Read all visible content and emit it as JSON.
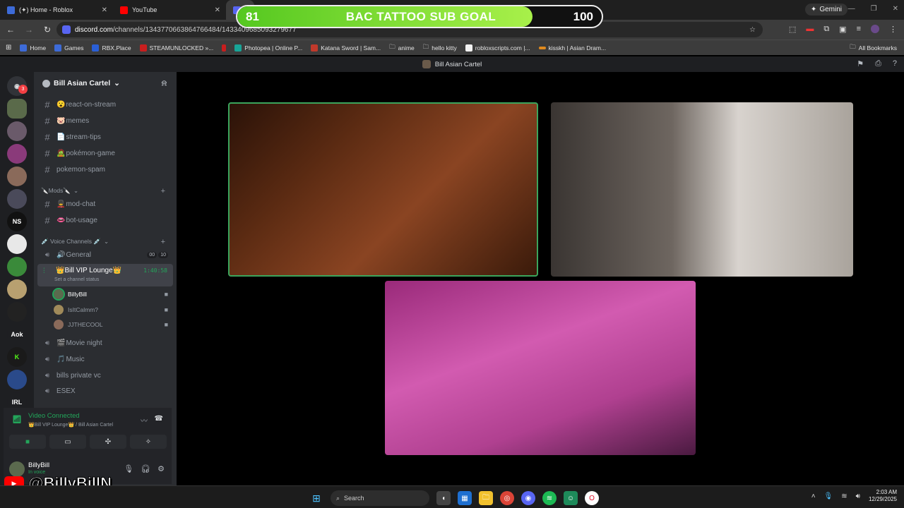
{
  "browser": {
    "tabs": [
      {
        "label": "(✦) Home - Roblox",
        "color": "#3d6bd8"
      },
      {
        "label": "YouTube",
        "color": "#ff0000"
      }
    ],
    "gemini_label": "Gemini",
    "url_host": "discord.com",
    "url_path": "/channels/1343770663864766484/1433409685093279677",
    "bookmarks": [
      {
        "label": "Home",
        "color": "#3d6bd8"
      },
      {
        "label": "Games",
        "color": "#3d6bd8"
      },
      {
        "label": "RBX.Place",
        "color": "#2a5fd6"
      },
      {
        "label": "STEAMUNLOCKED »...",
        "color": "#c81e1e"
      },
      {
        "label": "",
        "color": "#c81e1e"
      },
      {
        "label": "Photopea | Online P...",
        "color": "#18a497"
      },
      {
        "label": "Katana Sword | Sam...",
        "color": "#c0392b"
      },
      {
        "label": "anime",
        "color": "folder"
      },
      {
        "label": "hello kitty",
        "color": "folder"
      },
      {
        "label": "robloxscripts.com |...",
        "color": "#f2f2f2"
      },
      {
        "label": "kisskh | Asian Dram...",
        "color": "#e08a1e"
      }
    ],
    "all_bookmarks": "All Bookmarks"
  },
  "stream_overlay": {
    "current": "81",
    "goal": "100",
    "title": "BAC TATTOO SUB GOAL",
    "progress": 0.81
  },
  "discord": {
    "window_title": "Bill Asian Cartel",
    "rail_badge": "3",
    "rail_labels": {
      "ns": "NS",
      "aok": "Aok",
      "irl": "IRL"
    },
    "server_name": "Bill Asian Cartel",
    "text_channels": [
      {
        "emoji": "😮",
        "name": "react-on-stream"
      },
      {
        "emoji": "🐷",
        "name": "memes"
      },
      {
        "emoji": "📄",
        "name": "stream-tips"
      },
      {
        "emoji": "🧟",
        "name": "pokémon-game"
      },
      {
        "emoji": "",
        "name": "pokemon-spam"
      }
    ],
    "mods_category": "🔪Mods🔪",
    "mod_channels": [
      {
        "emoji": "💂",
        "name": "mod-chat"
      },
      {
        "emoji": "👄",
        "name": "bot-usage"
      }
    ],
    "voice_category": "💉 Voice Channels 💉",
    "general": {
      "emoji": "🔊",
      "name": "General",
      "pill1": "00",
      "pill2": "10"
    },
    "vip": {
      "name": "👑Bill VIP Lounge👑",
      "time": "1:40:58",
      "status": "Set a channel status"
    },
    "vip_users": [
      {
        "name": "BillyBill",
        "color": "#5b6a4e",
        "active": true
      },
      {
        "name": "IsItCalmm?",
        "color": "#a08a5a",
        "active": false
      },
      {
        "name": "JJTHECOOL",
        "color": "#8a6a5a",
        "active": false
      }
    ],
    "more_voice": [
      {
        "emoji": "🎬",
        "name": "Movie night"
      },
      {
        "emoji": "🎵",
        "name": "Music"
      },
      {
        "emoji": "",
        "name": "bills private vc"
      },
      {
        "emoji": "",
        "name": "ESEX"
      }
    ],
    "connection": {
      "status": "Video Connected",
      "location": "👑Bill VIP Lounge👑 / Bill Asian Cartel"
    },
    "me": {
      "name": "BillyBill",
      "status": "In voice"
    }
  },
  "watermark": {
    "handle": "@BillyBillN"
  },
  "taskbar": {
    "search_placeholder": "Search",
    "time": "2:03 AM",
    "date": "12/29/2025"
  }
}
